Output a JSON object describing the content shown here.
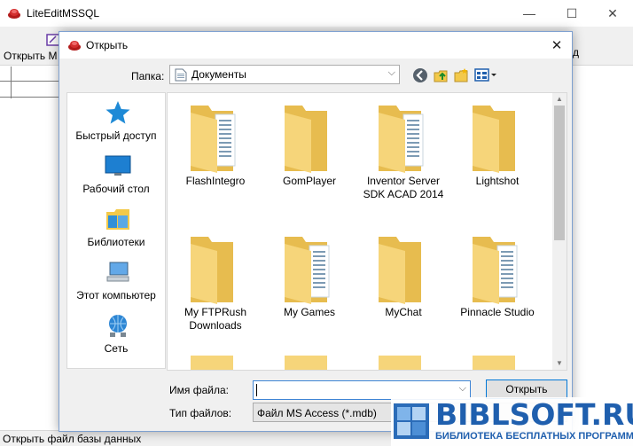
{
  "app": {
    "title": "LiteEditMSSQL",
    "toolbar_open_label": "Открыть М",
    "toolbar_right_label": "д",
    "status": "Открыть файл базы данных",
    "minimize_glyph": "—",
    "maximize_glyph": "☐",
    "close_glyph": "✕"
  },
  "dialog": {
    "title": "Открыть",
    "close_glyph": "✕",
    "folder_label": "Папка:",
    "folder_value": "Документы",
    "dropdown_glyph": "⌵",
    "places": [
      {
        "label": "Быстрый доступ",
        "icon": "star-icon"
      },
      {
        "label": "Рабочий стол",
        "icon": "desktop-icon"
      },
      {
        "label": "Библиотеки",
        "icon": "library-icon"
      },
      {
        "label": "Этот компьютер",
        "icon": "computer-icon"
      },
      {
        "label": "Сеть",
        "icon": "network-icon"
      }
    ],
    "folders": [
      {
        "name": "FlashIntegro",
        "has_docs": true
      },
      {
        "name": "GomPlayer",
        "has_docs": false
      },
      {
        "name": "Inventor Server\nSDK ACAD 2014",
        "has_docs": true
      },
      {
        "name": "Lightshot",
        "has_docs": false
      },
      {
        "name": "My FTPRush\nDownloads",
        "has_docs": false
      },
      {
        "name": "My Games",
        "has_docs": true
      },
      {
        "name": "MyChat",
        "has_docs": false
      },
      {
        "name": "Pinnacle Studio",
        "has_docs": true
      }
    ],
    "filename_label": "Имя файла:",
    "filename_value": "",
    "filetype_label": "Тип файлов:",
    "filetype_value": "Файл MS Access (*.mdb)",
    "open_button": "Открыть",
    "scroll_up_glyph": "▲",
    "scroll_down_glyph": "▼"
  },
  "watermark": {
    "brand": "BIBLSOFT.RU",
    "tagline": "БИБЛИОТЕКА БЕСПЛАТНЫХ ПРОГРАММ"
  },
  "colors": {
    "accent": "#0078d7",
    "folder": "#f6d57a",
    "brand_blue": "#1f5fae"
  }
}
